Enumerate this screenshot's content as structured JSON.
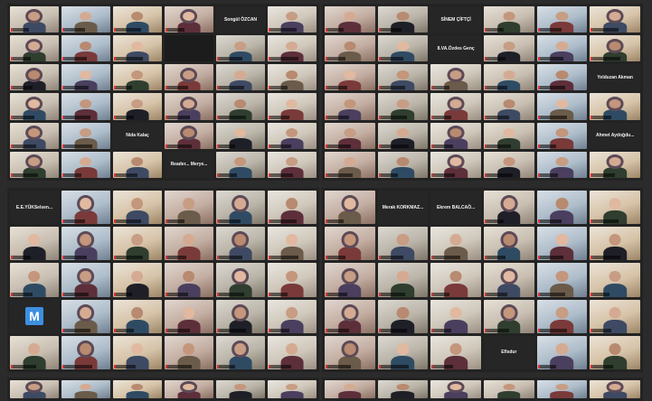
{
  "layout": {
    "screens": [
      {
        "id": "top-left",
        "cols": 6,
        "rows": 6,
        "name_tiles": {
          "4": "Songül ÖZCAN",
          "26": "Nida Kalaç",
          "33": "Reader... Merye..."
        },
        "empty_tiles": [
          9
        ]
      },
      {
        "id": "top-right",
        "cols": 6,
        "rows": 6,
        "name_tiles": {
          "2": "SİNEM ÇİFTÇİ",
          "8": "8.VA.Özdes Genç",
          "17": "Yelduzan Akman",
          "29": "Ahmet Aydoğdu..."
        },
        "empty_tiles": []
      },
      {
        "id": "bottom-left",
        "cols": 6,
        "rows": 5,
        "name_tiles": {
          "0": "E.E.YÜKSelsen..."
        },
        "logo_tiles": {
          "18": "M"
        },
        "empty_tiles": []
      },
      {
        "id": "bottom-right",
        "cols": 6,
        "rows": 5,
        "name_tiles": {
          "1": "Merak KORKMAZ...",
          "2": "Ekrem BALCAÖ...",
          "27": "Eflsdur"
        },
        "empty_tiles": []
      }
    ]
  }
}
